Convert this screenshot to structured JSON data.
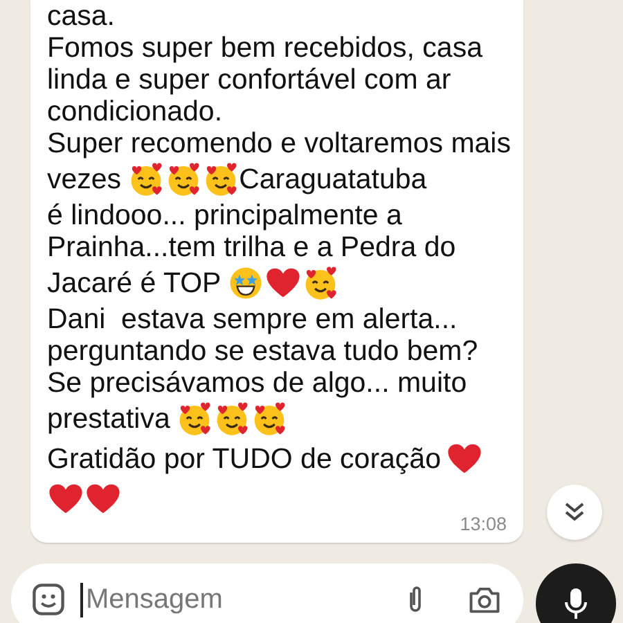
{
  "message": {
    "lines": [
      {
        "segments": [
          {
            "kind": "text",
            "text": "casa."
          }
        ]
      },
      {
        "segments": [
          {
            "kind": "text",
            "text": "Fomos super bem recebidos, casa"
          }
        ]
      },
      {
        "segments": [
          {
            "kind": "text",
            "text": "linda e super confortável com ar"
          }
        ]
      },
      {
        "segments": [
          {
            "kind": "text",
            "text": "condicionado."
          }
        ]
      },
      {
        "segments": [
          {
            "kind": "text",
            "text": "Super recomendo e voltaremos mais"
          }
        ]
      },
      {
        "segments": [
          {
            "kind": "text",
            "text": "vezes"
          },
          {
            "kind": "smitten"
          },
          {
            "kind": "smitten"
          },
          {
            "kind": "smitten"
          },
          {
            "kind": "text",
            "text": "Caraguatatuba"
          }
        ]
      },
      {
        "segments": [
          {
            "kind": "text",
            "text": "é lindooo... principalmente a"
          }
        ]
      },
      {
        "segments": [
          {
            "kind": "text",
            "text": "Prainha...tem trilha e a Pedra do"
          }
        ]
      },
      {
        "segments": [
          {
            "kind": "text",
            "text": "Jacaré é TOP"
          },
          {
            "kind": "starstruck"
          },
          {
            "kind": "heart"
          },
          {
            "kind": "smitten"
          }
        ]
      },
      {
        "segments": [
          {
            "kind": "text",
            "text": "Dani  estava sempre em alerta..."
          }
        ]
      },
      {
        "segments": [
          {
            "kind": "text",
            "text": "perguntando se estava tudo bem?"
          }
        ]
      },
      {
        "segments": [
          {
            "kind": "text",
            "text": "Se precisávamos de algo... muito"
          }
        ]
      },
      {
        "segments": [
          {
            "kind": "text",
            "text": "prestativa"
          },
          {
            "kind": "smitten"
          },
          {
            "kind": "smitten"
          },
          {
            "kind": "smitten"
          }
        ]
      },
      {
        "segments": [
          {
            "kind": "text",
            "text": "Gratidão por TUDO de coração"
          },
          {
            "kind": "heart"
          }
        ]
      },
      {
        "segments": [
          {
            "kind": "heart"
          },
          {
            "kind": "heart"
          }
        ]
      }
    ],
    "time": "13:08"
  },
  "composer": {
    "placeholder": "Mensagem"
  }
}
